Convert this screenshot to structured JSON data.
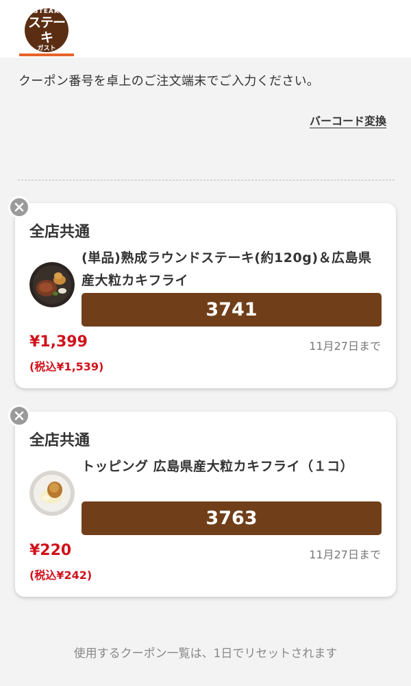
{
  "header": {
    "logo": {
      "line1": "STEAK",
      "line2": "ステーキ",
      "line3": "ガスト"
    }
  },
  "instruction": "クーポン番号を卓上のご注文端末でご入力ください。",
  "barcode_link": "バーコード変換",
  "coupons": [
    {
      "store": "全店共通",
      "title": "(単品)熟成ラウンドステーキ(約120g)＆広島県産大粒カキフライ",
      "code": "3741",
      "price": "¥1,399",
      "tax": "(税込¥1,539)",
      "expiry": "11月27日まで",
      "image_icon": "steak-plate-image"
    },
    {
      "store": "全店共通",
      "title": "トッピング 広島県産大粒カキフライ（１コ）",
      "code": "3763",
      "price": "¥220",
      "tax": "(税込¥242)",
      "expiry": "11月27日まで",
      "image_icon": "oyster-fry-image"
    }
  ],
  "footer_note": "使用するクーポン一覧は、1日でリセットされます",
  "colors": {
    "accent": "#e8622a",
    "code_button": "#703f1a",
    "price": "#d0121b",
    "logo_bg": "#5b2e14",
    "background": "#f3f3f3"
  }
}
